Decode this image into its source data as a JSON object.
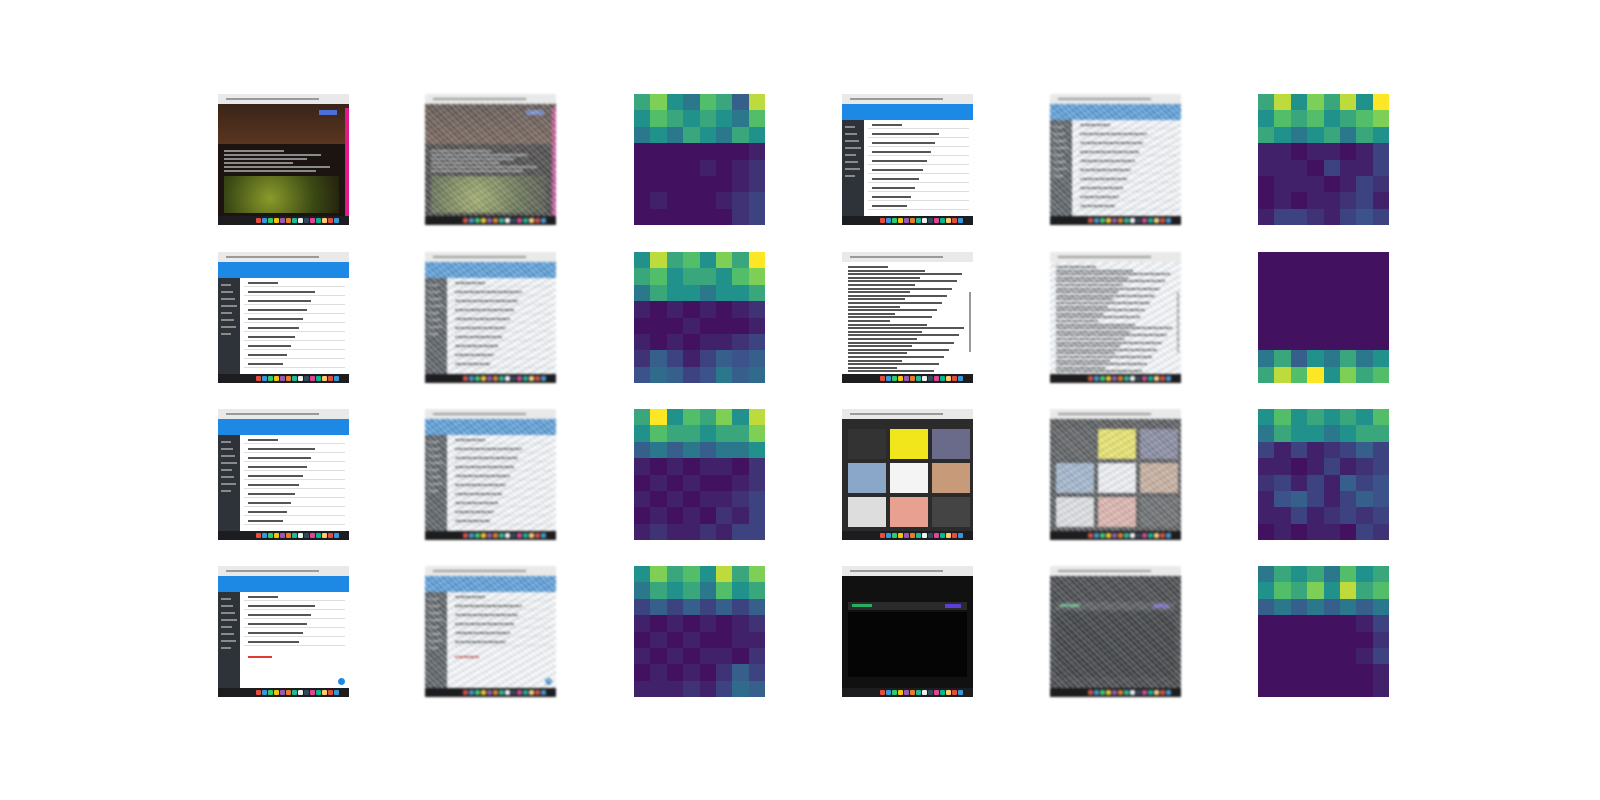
{
  "figure": {
    "rows": 4,
    "columns": 6,
    "column_roles": [
      "screenshot",
      "reconstruction",
      "attention-map",
      "screenshot",
      "reconstruction",
      "attention-map"
    ],
    "panels": [
      {
        "row": 0,
        "kind": "game-page"
      },
      {
        "row": 0,
        "kind": "admin-list"
      },
      {
        "row": 1,
        "kind": "admin-table"
      },
      {
        "row": 1,
        "kind": "document"
      },
      {
        "row": 2,
        "kind": "admin-list"
      },
      {
        "row": 2,
        "kind": "image-grid"
      },
      {
        "row": 3,
        "kind": "admin-form"
      },
      {
        "row": 3,
        "kind": "dark-page"
      }
    ]
  },
  "colors": {
    "background": "#ffffff",
    "accent_blue": "#1e88e5",
    "sidebar": "#2d3338",
    "dock": "#1d1d1f",
    "viridis_low": "#440154",
    "viridis_high": "#fde725"
  },
  "heatmaps": [
    {
      "id": "r0-a",
      "values": [
        [
          0.6,
          0.8,
          0.5,
          0.4,
          0.7,
          0.6,
          0.3,
          0.9
        ],
        [
          0.5,
          0.7,
          0.6,
          0.5,
          0.6,
          0.5,
          0.4,
          0.7
        ],
        [
          0.4,
          0.5,
          0.4,
          0.6,
          0.5,
          0.4,
          0.6,
          0.5
        ],
        [
          0.05,
          0.05,
          0.05,
          0.05,
          0.05,
          0.05,
          0.05,
          0.1
        ],
        [
          0.05,
          0.05,
          0.05,
          0.05,
          0.1,
          0.05,
          0.1,
          0.15
        ],
        [
          0.05,
          0.05,
          0.05,
          0.05,
          0.05,
          0.05,
          0.1,
          0.15
        ],
        [
          0.05,
          0.1,
          0.05,
          0.05,
          0.05,
          0.1,
          0.15,
          0.2
        ],
        [
          0.05,
          0.05,
          0.05,
          0.05,
          0.05,
          0.05,
          0.15,
          0.2
        ]
      ]
    },
    {
      "id": "r0-b",
      "values": [
        [
          0.6,
          0.9,
          0.5,
          0.8,
          0.6,
          0.9,
          0.5,
          1.0
        ],
        [
          0.5,
          0.7,
          0.6,
          0.7,
          0.5,
          0.6,
          0.7,
          0.8
        ],
        [
          0.6,
          0.5,
          0.4,
          0.5,
          0.6,
          0.4,
          0.6,
          0.5
        ],
        [
          0.1,
          0.1,
          0.05,
          0.1,
          0.1,
          0.05,
          0.1,
          0.2
        ],
        [
          0.1,
          0.1,
          0.1,
          0.05,
          0.2,
          0.1,
          0.1,
          0.2
        ],
        [
          0.05,
          0.1,
          0.1,
          0.1,
          0.05,
          0.1,
          0.2,
          0.15
        ],
        [
          0.05,
          0.1,
          0.05,
          0.1,
          0.1,
          0.15,
          0.2,
          0.1
        ],
        [
          0.1,
          0.2,
          0.2,
          0.15,
          0.1,
          0.2,
          0.25,
          0.2
        ]
      ]
    },
    {
      "id": "r1-a",
      "values": [
        [
          0.5,
          0.9,
          0.6,
          0.7,
          0.5,
          0.8,
          0.6,
          1.0
        ],
        [
          0.6,
          0.7,
          0.5,
          0.6,
          0.6,
          0.5,
          0.7,
          0.8
        ],
        [
          0.4,
          0.6,
          0.5,
          0.5,
          0.4,
          0.5,
          0.5,
          0.6
        ],
        [
          0.1,
          0.05,
          0.1,
          0.05,
          0.1,
          0.05,
          0.1,
          0.15
        ],
        [
          0.05,
          0.05,
          0.05,
          0.1,
          0.05,
          0.05,
          0.05,
          0.1
        ],
        [
          0.1,
          0.05,
          0.1,
          0.05,
          0.1,
          0.1,
          0.15,
          0.2
        ],
        [
          0.15,
          0.3,
          0.2,
          0.1,
          0.2,
          0.3,
          0.25,
          0.3
        ],
        [
          0.25,
          0.35,
          0.3,
          0.2,
          0.25,
          0.4,
          0.3,
          0.35
        ]
      ]
    },
    {
      "id": "r1-b",
      "values": [
        [
          0.05,
          0.05,
          0.05,
          0.05,
          0.05,
          0.05,
          0.05,
          0.05
        ],
        [
          0.05,
          0.05,
          0.05,
          0.05,
          0.05,
          0.05,
          0.05,
          0.05
        ],
        [
          0.05,
          0.05,
          0.05,
          0.05,
          0.05,
          0.05,
          0.05,
          0.05
        ],
        [
          0.05,
          0.05,
          0.05,
          0.05,
          0.05,
          0.05,
          0.05,
          0.05
        ],
        [
          0.05,
          0.05,
          0.05,
          0.05,
          0.05,
          0.05,
          0.05,
          0.05
        ],
        [
          0.05,
          0.05,
          0.05,
          0.05,
          0.05,
          0.05,
          0.05,
          0.05
        ],
        [
          0.4,
          0.6,
          0.3,
          0.5,
          0.4,
          0.6,
          0.4,
          0.5
        ],
        [
          0.6,
          0.9,
          0.7,
          1.0,
          0.5,
          0.8,
          0.6,
          0.7
        ]
      ]
    },
    {
      "id": "r2-a",
      "values": [
        [
          0.6,
          1.0,
          0.5,
          0.7,
          0.6,
          0.8,
          0.5,
          0.9
        ],
        [
          0.5,
          0.7,
          0.6,
          0.6,
          0.5,
          0.6,
          0.6,
          0.8
        ],
        [
          0.3,
          0.4,
          0.3,
          0.4,
          0.3,
          0.4,
          0.4,
          0.5
        ],
        [
          0.1,
          0.05,
          0.1,
          0.05,
          0.1,
          0.1,
          0.05,
          0.15
        ],
        [
          0.05,
          0.1,
          0.05,
          0.1,
          0.05,
          0.05,
          0.1,
          0.15
        ],
        [
          0.1,
          0.05,
          0.1,
          0.05,
          0.1,
          0.1,
          0.15,
          0.2
        ],
        [
          0.05,
          0.1,
          0.05,
          0.1,
          0.05,
          0.15,
          0.1,
          0.2
        ],
        [
          0.1,
          0.15,
          0.1,
          0.1,
          0.15,
          0.1,
          0.2,
          0.2
        ]
      ]
    },
    {
      "id": "r2-b",
      "values": [
        [
          0.5,
          0.7,
          0.5,
          0.6,
          0.5,
          0.6,
          0.5,
          0.7
        ],
        [
          0.4,
          0.6,
          0.5,
          0.5,
          0.4,
          0.5,
          0.6,
          0.6
        ],
        [
          0.2,
          0.1,
          0.2,
          0.1,
          0.15,
          0.2,
          0.3,
          0.2
        ],
        [
          0.1,
          0.1,
          0.05,
          0.1,
          0.2,
          0.1,
          0.15,
          0.2
        ],
        [
          0.15,
          0.2,
          0.1,
          0.2,
          0.1,
          0.3,
          0.2,
          0.25
        ],
        [
          0.1,
          0.25,
          0.3,
          0.2,
          0.1,
          0.2,
          0.3,
          0.25
        ],
        [
          0.1,
          0.1,
          0.2,
          0.1,
          0.15,
          0.2,
          0.15,
          0.2
        ],
        [
          0.05,
          0.1,
          0.05,
          0.1,
          0.1,
          0.05,
          0.2,
          0.15
        ]
      ]
    },
    {
      "id": "r3-a",
      "values": [
        [
          0.5,
          0.8,
          0.6,
          0.7,
          0.5,
          0.9,
          0.6,
          0.8
        ],
        [
          0.4,
          0.6,
          0.5,
          0.6,
          0.4,
          0.7,
          0.5,
          0.6
        ],
        [
          0.2,
          0.3,
          0.2,
          0.3,
          0.2,
          0.3,
          0.2,
          0.3
        ],
        [
          0.1,
          0.05,
          0.1,
          0.05,
          0.1,
          0.05,
          0.1,
          0.15
        ],
        [
          0.05,
          0.1,
          0.05,
          0.1,
          0.05,
          0.05,
          0.1,
          0.1
        ],
        [
          0.1,
          0.05,
          0.1,
          0.05,
          0.1,
          0.1,
          0.05,
          0.15
        ],
        [
          0.05,
          0.1,
          0.05,
          0.1,
          0.05,
          0.15,
          0.3,
          0.2
        ],
        [
          0.1,
          0.1,
          0.1,
          0.15,
          0.1,
          0.2,
          0.35,
          0.3
        ]
      ]
    },
    {
      "id": "r3-b",
      "values": [
        [
          0.4,
          0.6,
          0.5,
          0.6,
          0.4,
          0.7,
          0.5,
          0.6
        ],
        [
          0.5,
          0.7,
          0.6,
          0.8,
          0.5,
          0.9,
          0.6,
          0.7
        ],
        [
          0.3,
          0.4,
          0.3,
          0.4,
          0.3,
          0.4,
          0.3,
          0.4
        ],
        [
          0.05,
          0.05,
          0.05,
          0.05,
          0.05,
          0.05,
          0.1,
          0.2
        ],
        [
          0.05,
          0.05,
          0.05,
          0.05,
          0.05,
          0.05,
          0.05,
          0.15
        ],
        [
          0.05,
          0.05,
          0.05,
          0.05,
          0.05,
          0.05,
          0.1,
          0.2
        ],
        [
          0.05,
          0.05,
          0.05,
          0.05,
          0.05,
          0.05,
          0.05,
          0.1
        ],
        [
          0.05,
          0.05,
          0.05,
          0.05,
          0.05,
          0.05,
          0.05,
          0.1
        ]
      ]
    }
  ]
}
